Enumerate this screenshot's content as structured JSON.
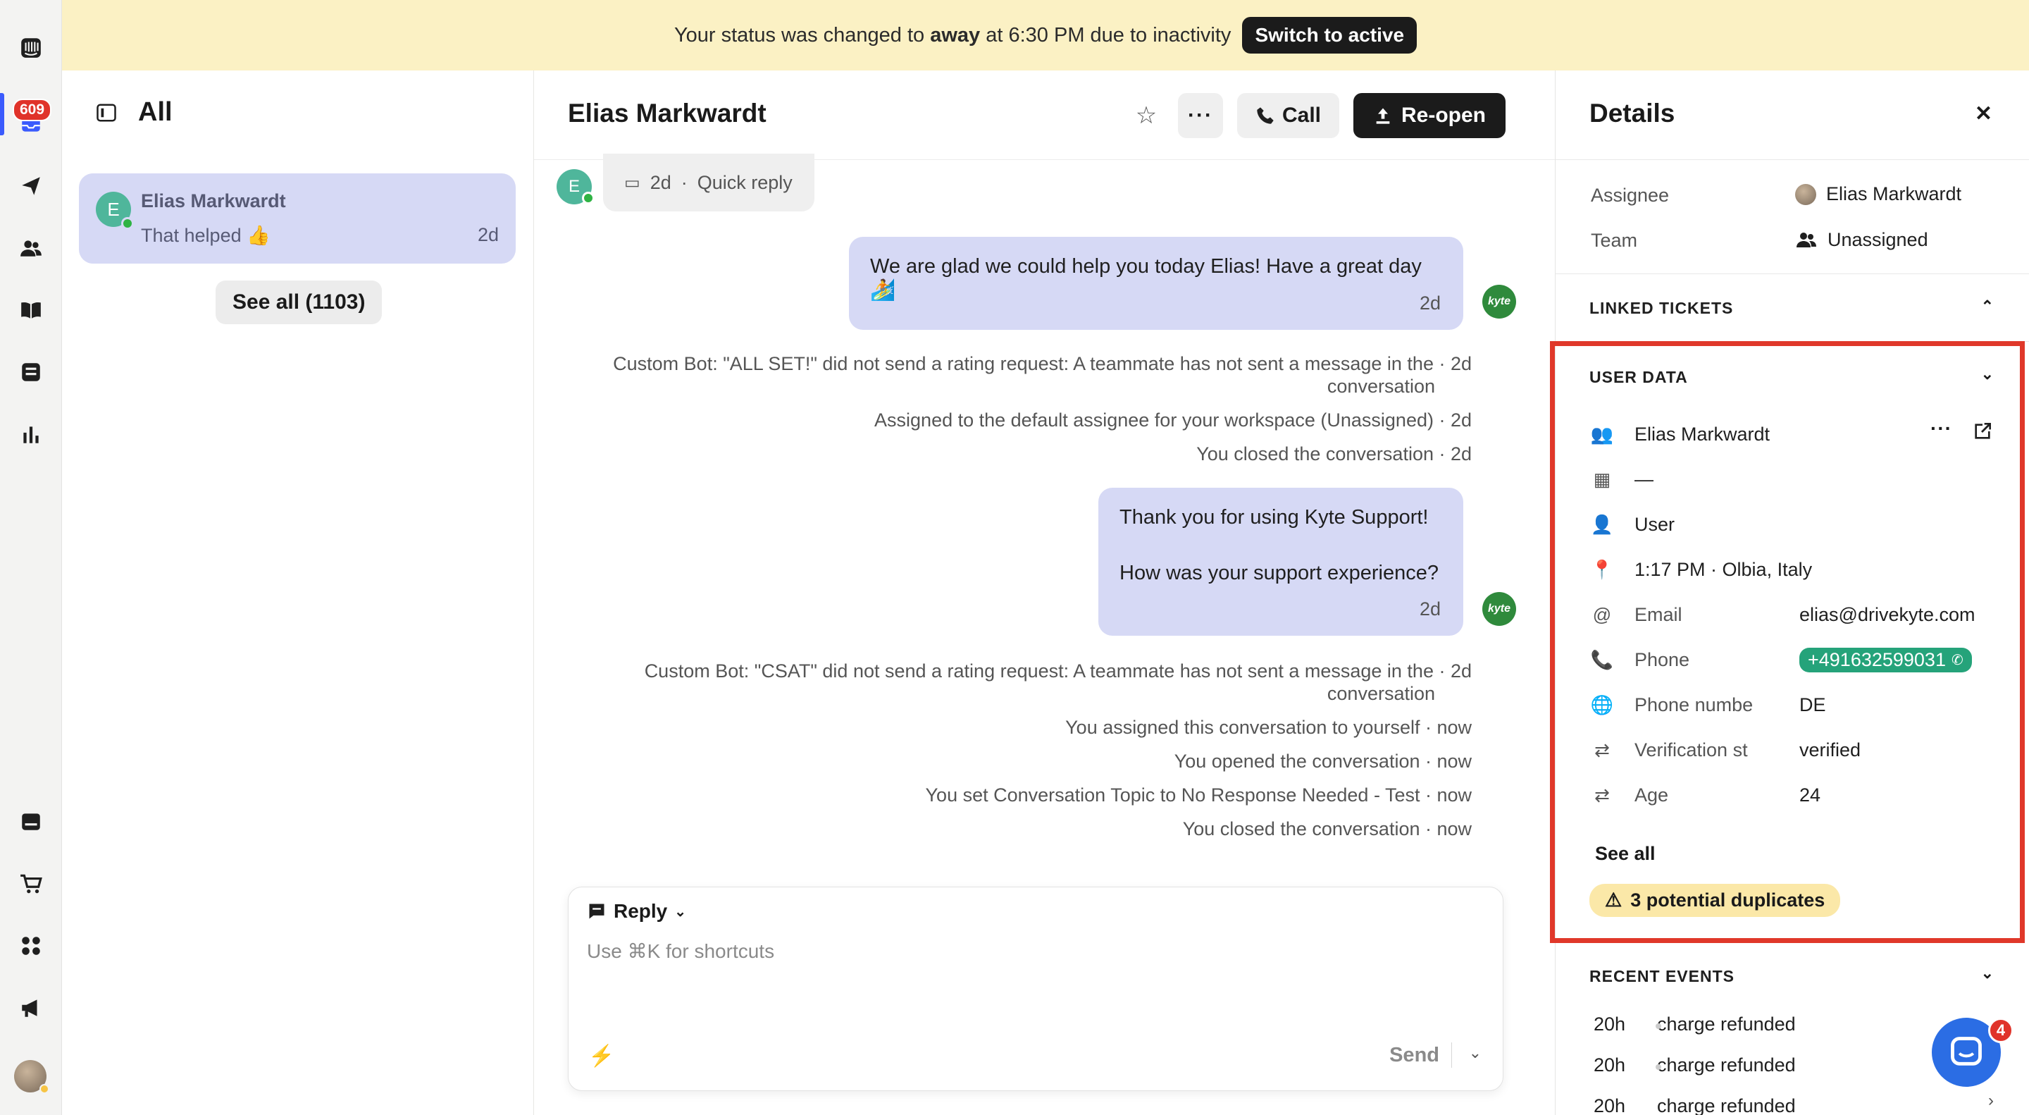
{
  "rail": {
    "inbox_badge": "609"
  },
  "banner": {
    "prefix": "Your status was changed to",
    "status": "away",
    "suffix": "at 6:30 PM due to inactivity",
    "button": "Switch to active"
  },
  "list": {
    "title": "All",
    "conversation": {
      "avatar_letter": "E",
      "name": "Elias Markwardt",
      "message": "That helped 👍",
      "time": "2d"
    },
    "see_all": "See all (1103)"
  },
  "conversation": {
    "title": "Elias Markwardt",
    "call_label": "Call",
    "reopen_label": "Re-open",
    "quick_reply": {
      "avatar_letter": "E",
      "time": "2d",
      "label": "Quick reply"
    },
    "bubble1": {
      "text": "We are glad we could help you today Elias! Have a great day 🏄",
      "time": "2d"
    },
    "events1": [
      "Custom Bot: \"ALL SET!\" did not send a rating request: A teammate has not sent a message in the · 2d",
      "conversation",
      "Assigned to the default assignee for your workspace (Unassigned) · 2d",
      "You closed the conversation · 2d"
    ],
    "bubble2": {
      "line1": "Thank you for using Kyte Support!",
      "line2": "How was your support experience?",
      "time": "2d"
    },
    "events2": [
      "Custom Bot: \"CSAT\" did not send a rating request: A teammate has not sent a message in the · 2d",
      "conversation",
      "You assigned this conversation to yourself · now",
      "You opened the conversation · now",
      "You set Conversation Topic to No Response Needed - Test · now",
      "You closed the conversation · now"
    ],
    "kyte_label": "kyte",
    "composer": {
      "mode": "Reply",
      "placeholder": "Use ⌘K for shortcuts",
      "send": "Send"
    }
  },
  "details": {
    "title": "Details",
    "assignee_label": "Assignee",
    "assignee_value": "Elias Markwardt",
    "team_label": "Team",
    "team_value": "Unassigned",
    "linked_tickets": "LINKED TICKETS",
    "user_data": {
      "heading": "USER DATA",
      "name": "Elias Markwardt",
      "company": "—",
      "role": "User",
      "location": "1:17 PM · Olbia, Italy",
      "email_label": "Email",
      "email_value": "elias@drivekyte.com",
      "phone_label": "Phone",
      "phone_value": "+491632599031",
      "phone_country_label": "Phone numbe",
      "phone_country_value": "DE",
      "verification_label": "Verification st",
      "verification_value": "verified",
      "age_label": "Age",
      "age_value": "24",
      "see_all": "See all",
      "duplicates": "3 potential duplicates"
    },
    "recent_events": {
      "heading": "RECENT EVENTS",
      "items": [
        {
          "time": "20h",
          "label": "charge refunded"
        },
        {
          "time": "20h",
          "label": "charge refunded"
        },
        {
          "time": "20h",
          "label": "charge refunded"
        }
      ]
    },
    "messenger_badge": "4"
  },
  "colors": {
    "accent": "#3b5bfd",
    "highlight": "#e0382a",
    "banner": "#fbf1c4",
    "bubble": "#d6d9f5",
    "phone_pill": "#25a37a"
  }
}
